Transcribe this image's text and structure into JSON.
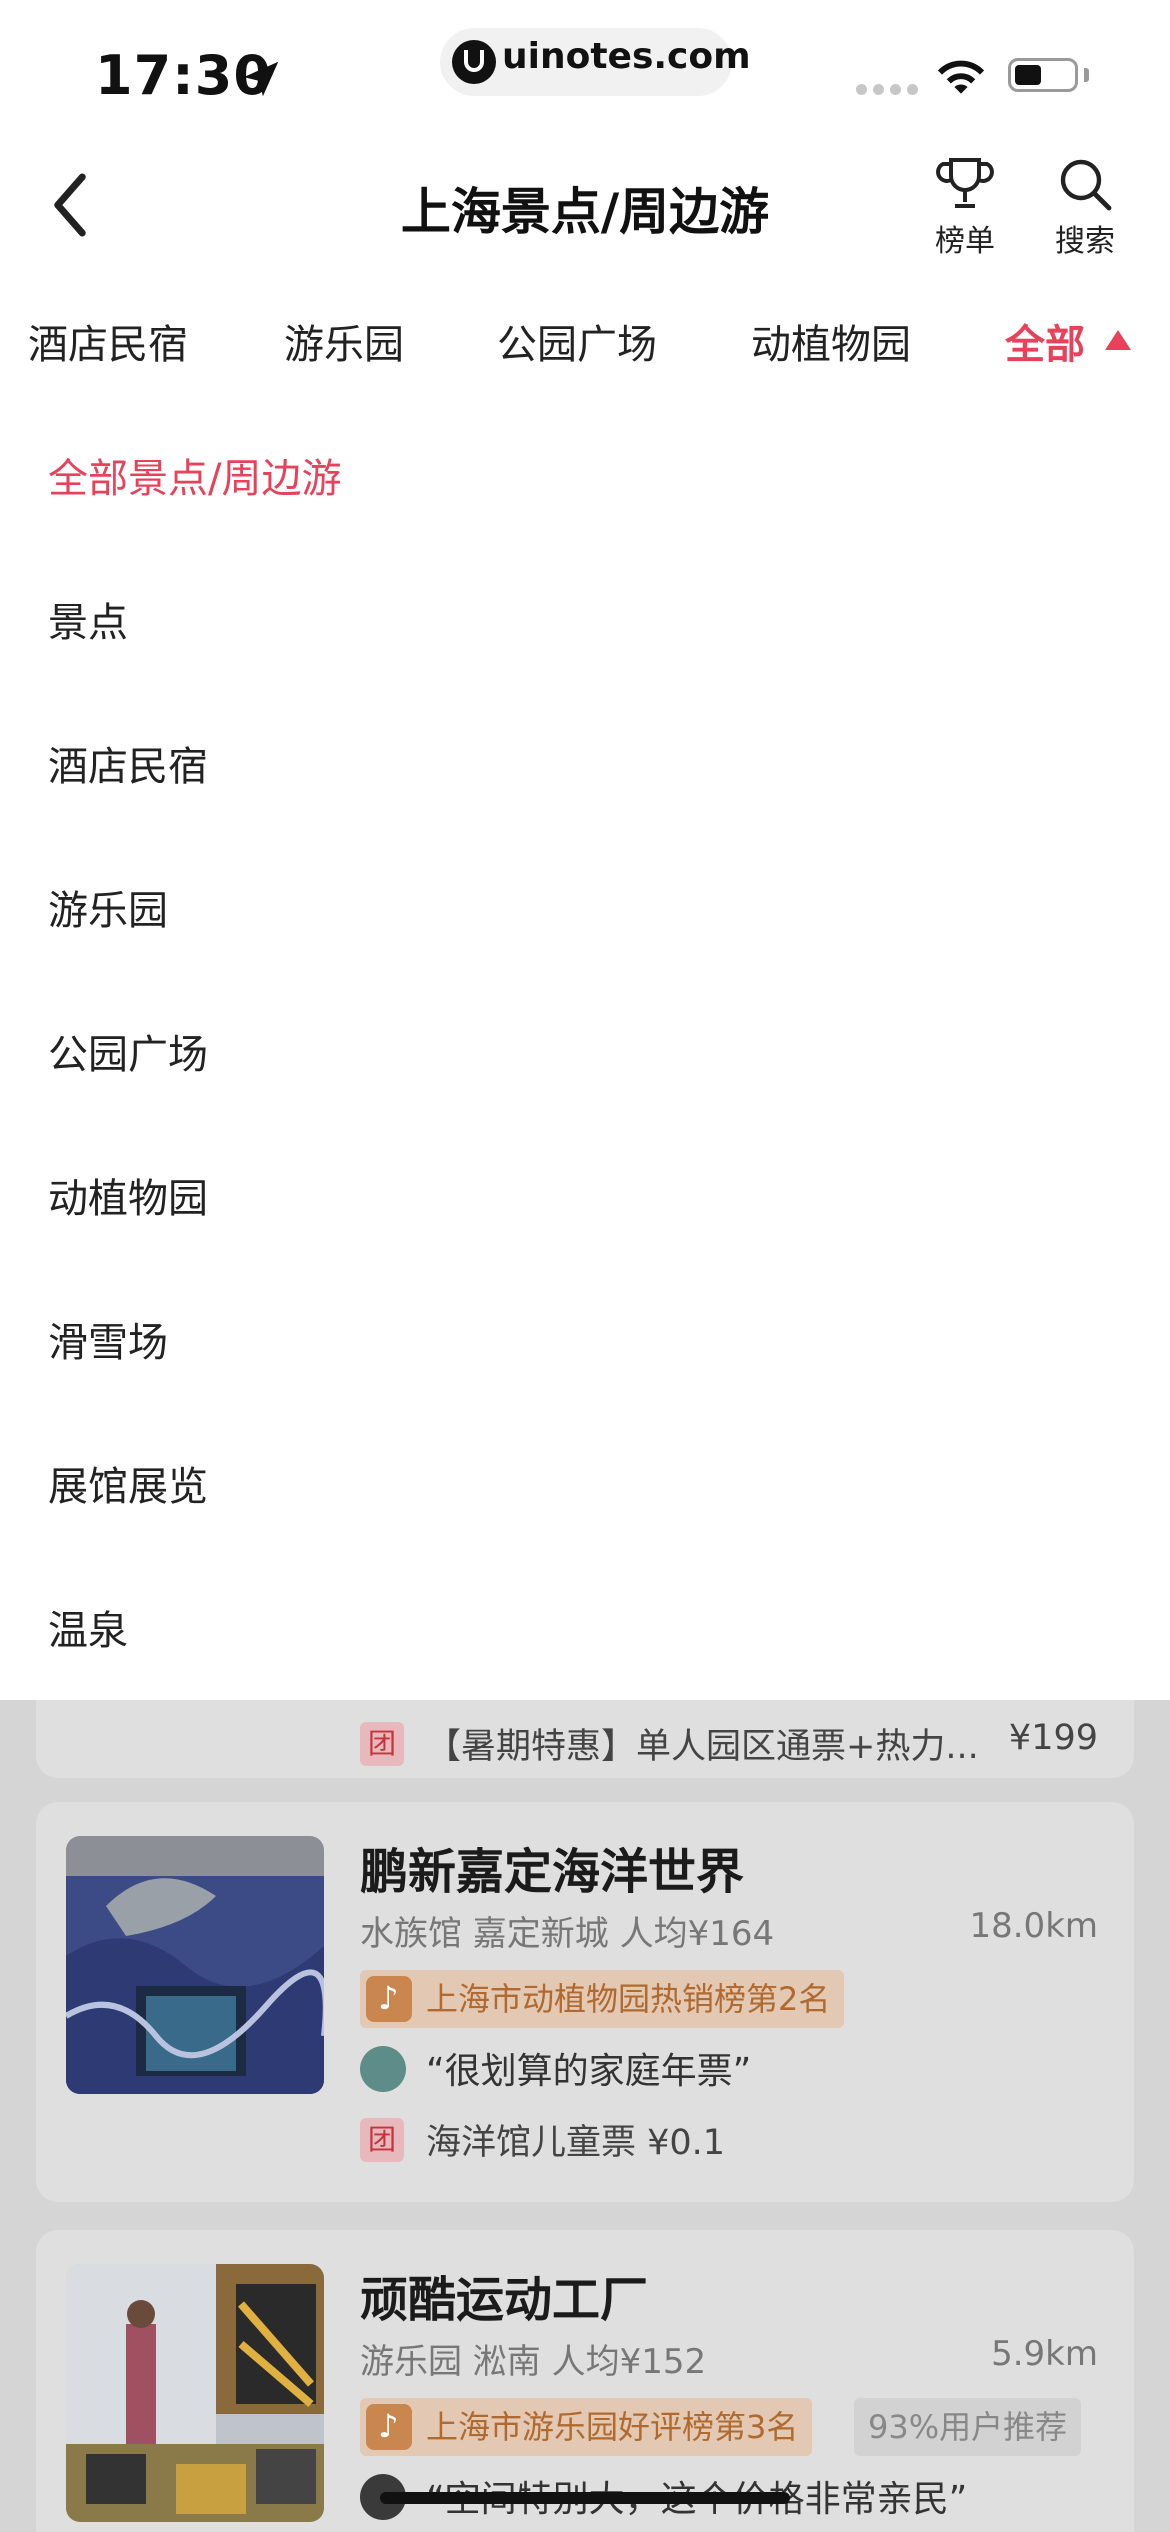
{
  "status_bar": {
    "time": "17:30",
    "url": "uinotes.com",
    "battery_level": 0.45
  },
  "header": {
    "back_icon": "chevron-left-icon",
    "title": "上海景点/周边游",
    "rank_label": "榜单",
    "search_label": "搜索"
  },
  "category_tabs": {
    "items": [
      "酒店民宿",
      "游乐园",
      "公园广场",
      "动植物园"
    ],
    "all_label": "全部"
  },
  "dropdown": {
    "active": "全部景点/周边游",
    "items": [
      "景点",
      "酒店民宿",
      "游乐园",
      "公园广场",
      "动植物园",
      "滑雪场",
      "展馆展览",
      "温泉"
    ]
  },
  "partial_card": {
    "deal_text": "【暑期特惠】单人园区通票+热力...",
    "deal_price": "¥199"
  },
  "cards": [
    {
      "title": "鹏新嘉定海洋世界",
      "meta": "水族馆   嘉定新城   人均¥164",
      "distance": "18.0km",
      "rank": "上海市动植物园热销榜第2名",
      "quote": "“很划算的家庭年票”",
      "deal": "海洋馆儿童票 ¥0.1"
    },
    {
      "title": "顽酷运动工厂",
      "meta": "游乐园   淞南   人均¥152",
      "distance": "5.9km",
      "rank": "上海市游乐园好评榜第3名",
      "recommend": "93%用户推荐",
      "quote": "“空间特别大，这个价格非常亲民”"
    }
  ],
  "colors": {
    "accent": "#e8425b",
    "rank_tag_text": "#b0692f",
    "dim": "#d5d5d5"
  }
}
